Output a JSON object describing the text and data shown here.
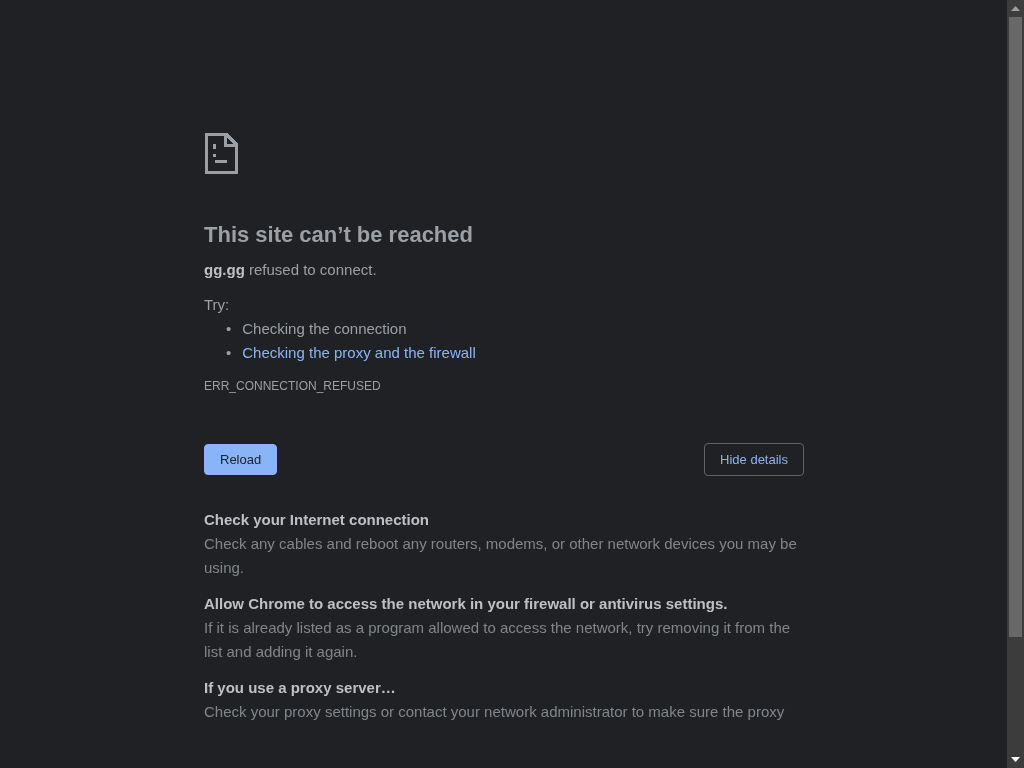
{
  "title": "This site can’t be reached",
  "summary": "**gg.gg** refused to connect.",
  "suggestions_label": "Try:",
  "suggestions": [
    {
      "kind": "text",
      "marker": "•",
      "text": "Checking the connection"
    },
    {
      "kind": "link",
      "marker": "•",
      "text": "Checking the proxy and the firewall"
    }
  ],
  "error_code": "ERR_CONNECTION_REFUSED",
  "buttons": [
    {
      "kind": "primary",
      "label": "Reload"
    },
    {
      "kind": "secondary",
      "label": "Hide details"
    }
  ],
  "details": [
    {
      "heading": "Check your Internet connection",
      "text": "Check any cables and reboot any routers, modems, or other network devices you may be using."
    },
    {
      "heading": "Allow Chrome to access the network in your firewall or antivirus settings.",
      "text": "If it is already listed as a program allowed to access the network, try removing it from the list and adding it again."
    },
    {
      "heading": "If you use a proxy server…",
      "text": "Check your proxy settings or contact your network administrator to make sure the proxy"
    }
  ]
}
